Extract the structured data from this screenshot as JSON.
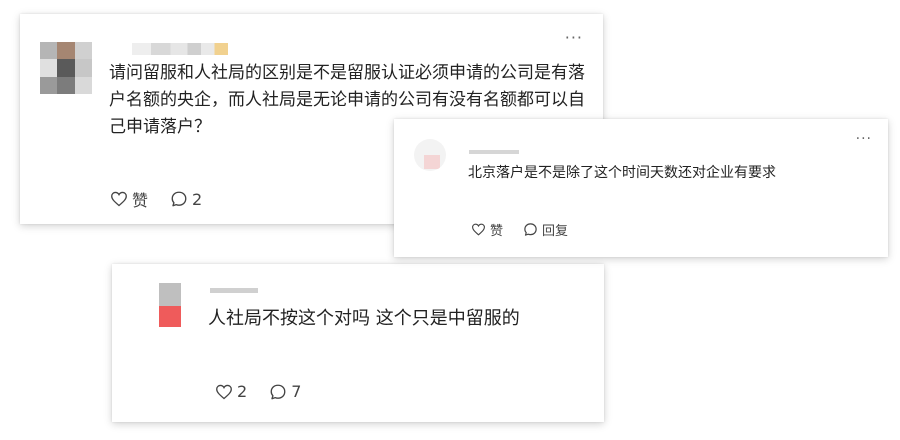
{
  "card1": {
    "text": "请问留服和人社局的区别是不是留服认证必须申请的公司是有落户名额的央企，而人社局是无论申请的公司有没有名额都可以自己申请落户？",
    "more_icon": "ellipsis-icon",
    "more_label": "···",
    "like_label": "赞",
    "comment_count": "2"
  },
  "card2": {
    "text": "北京落户是不是除了这个时间天数还对企业有要求",
    "more_icon": "ellipsis-icon",
    "more_label": "···",
    "like_label": "赞",
    "reply_label": "回复"
  },
  "card3": {
    "text": "人社局不按这个对吗 这个只是中留服的",
    "like_count": "2",
    "comment_count": "7"
  },
  "colors": {
    "card_bg": "#ffffff",
    "text": "#222222",
    "icon": "#444444",
    "avatar_red": "#ef5b5b"
  }
}
